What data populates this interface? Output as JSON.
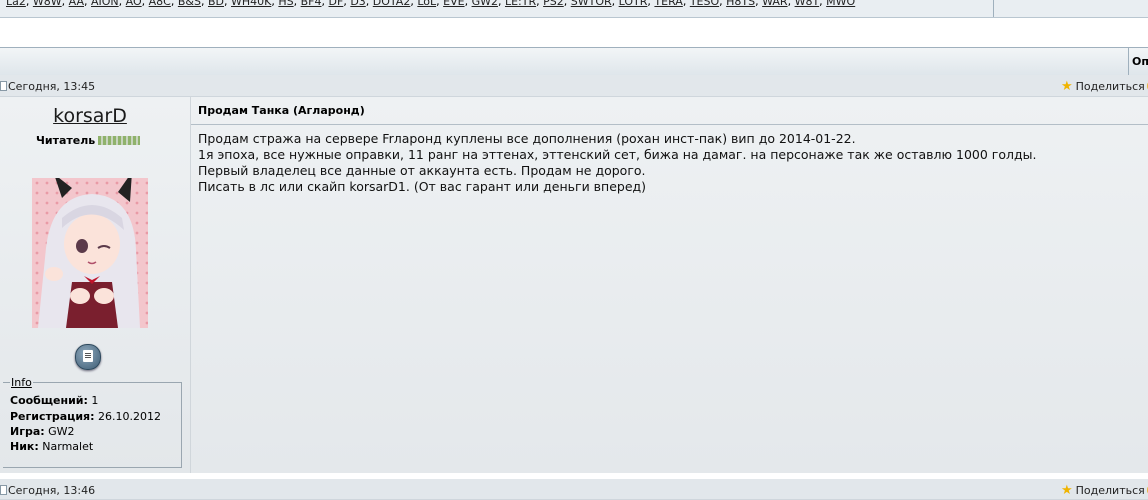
{
  "top_nav": {
    "links": [
      "La2",
      "W8W",
      "AA",
      "AION",
      "AO",
      "A8C",
      "B&S",
      "BD",
      "WH40K",
      "HS",
      "BF4",
      "DF",
      "D3",
      "DOTA2",
      "LoL",
      "EVE",
      "GW2",
      "LE:TR",
      "PS2",
      "SWTOR",
      "LOTR",
      "TERA",
      "TESO",
      "H8TS",
      "WAR",
      "W8T",
      "MWO"
    ]
  },
  "section_band": {
    "options_label": "Оп"
  },
  "post1": {
    "date": "Сегодня, 13:45",
    "share_label": "Поделиться",
    "author": {
      "username": "korsarD",
      "rank": "Читатель",
      "info_legend": "Info",
      "info": [
        {
          "label": "Сообщений:",
          "value": "1"
        },
        {
          "label": "Регистрация:",
          "value": "26.10.2012"
        },
        {
          "label": "Игра:",
          "value": "GW2"
        },
        {
          "label": "Ник:",
          "value": "Narmalet"
        }
      ]
    },
    "title": "Продам Танка (Агларонд)",
    "body_lines": [
      "Продам стража на сервере Frларонд куплены все дополнения (рохан инст-пак) вип до 2014-01-22.",
      "1я эпоха, все нужные оправки, 11 ранг на эттенах, эттенский сет, бижа на дамаг. на персонаже так же оставлю 1000 голды.",
      "Первый владелец все данные от аккаунта есть. Продам не дорого.",
      "Писать в лс или скайп korsarD1. (От вас гарант или деньги вперед)"
    ]
  },
  "post2": {
    "date": "Сегодня, 13:46",
    "share_label": "Поделиться"
  },
  "icons": {
    "share": "star-icon",
    "message": "private-message-icon",
    "post_date": "post-document-icon"
  },
  "colors": {
    "post_bar": "#e2e7eb",
    "panel": "#e9ecef",
    "border": "#9fb0bd",
    "share_star": "#f0b400"
  }
}
